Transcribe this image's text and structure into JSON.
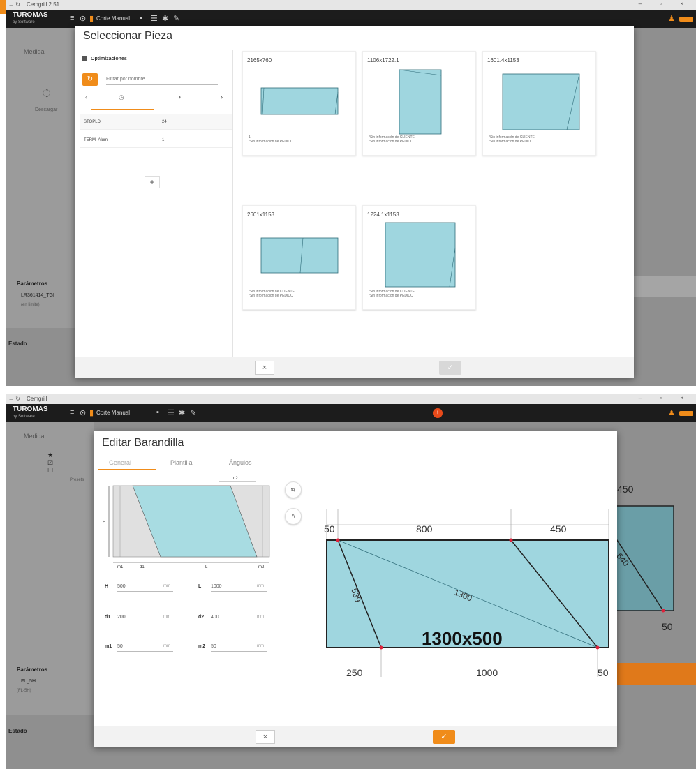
{
  "colors": {
    "accent": "#f08c1a",
    "glass": "#9fd6df",
    "glass_stroke": "#2e6b78",
    "appbar": "#1c1c1c",
    "overlay": "#8f8f8f"
  },
  "top": {
    "window_title": "Cemgrill 2.51",
    "nav_back": "←  ↻",
    "window_controls": "–  ▫  ×",
    "app": {
      "brand": "TUROMAS",
      "brand_sub": "by Software",
      "toolbar_label": "Corte Manual"
    },
    "background": {
      "medida_label": "Medida",
      "descarga_label": "Descargar",
      "parametros_label": "Parámetros",
      "parametros_item": "LR361414_TGI",
      "parametros_sub": "(en límite)",
      "estado_label": "Estado"
    },
    "modal": {
      "title": "Seleccionar Pieza",
      "optimizaciones_label": "Optimizaciones",
      "refresh_icon": "refresh-icon",
      "filter_placeholder": "Filtrar por nombre",
      "tab_prev": "‹",
      "tab_next": "›",
      "tab_icon_1": "◷",
      "tab_icon_2": "◑",
      "optimizations": [
        {
          "name": "STOPLDI",
          "count": "24"
        },
        {
          "name": "TERM_Alumi",
          "count": "1"
        }
      ],
      "add_label": "+",
      "pieces": [
        {
          "dim": "2165x760",
          "note_line1": "1",
          "note_line2": "*Sin información de PEDIDO"
        },
        {
          "dim": "1106x1722.1",
          "note_line1": "*Sin información de CLIENTE",
          "note_line2": "*Sin información de PEDIDO"
        },
        {
          "dim": "1601.4x1153",
          "note_line1": "*Sin información de CLIENTE",
          "note_line2": "*Sin información de PEDIDO"
        },
        {
          "dim": "2601x1153",
          "note_line1": "*Sin información de CLIENTE",
          "note_line2": "*Sin información de PEDIDO"
        },
        {
          "dim": "1224.1x1153",
          "note_line1": "*Sin información de CLIENTE",
          "note_line2": "*Sin información de PEDIDO"
        }
      ],
      "cancel_label": "×",
      "accept_label": "✓"
    }
  },
  "bottom": {
    "window_title": "Cemgrill",
    "nav_back": "←  ↻",
    "window_controls": "–  ▫  ×",
    "app": {
      "brand": "TUROMAS",
      "brand_sub": "by Software",
      "toolbar_label": "Corte Manual",
      "alert_label": "!"
    },
    "background": {
      "medida_label": "Medida",
      "presets_label": "Presets",
      "parametros_label": "Parámetros",
      "parametros_item": "FL_5H",
      "parametros_sub": "(FL-5H)",
      "estado_label": "Estado",
      "bg_450": "450",
      "bg_50": "50",
      "bg_angle": "640"
    },
    "modal": {
      "title": "Editar Barandilla",
      "tabs": [
        "General",
        "Plantilla",
        "Ángulos"
      ],
      "schematic": {
        "h": "H",
        "l": "L",
        "d1": "d1",
        "d2": "d2",
        "m1": "m1",
        "m2": "m2"
      },
      "fields": [
        {
          "label": "H",
          "value": "500",
          "unit": "mm"
        },
        {
          "label": "L",
          "value": "1000",
          "unit": "mm"
        },
        {
          "label": "d1",
          "value": "200",
          "unit": "mm"
        },
        {
          "label": "d2",
          "value": "400",
          "unit": "mm"
        },
        {
          "label": "m1",
          "value": "50",
          "unit": "mm"
        },
        {
          "label": "m2",
          "value": "50",
          "unit": "mm"
        }
      ],
      "swap_btn": "⇆",
      "mirror_btn": "\\\\",
      "preview": {
        "top_left": "50",
        "top_mid": "800",
        "top_right": "450",
        "bottom_left": "250",
        "bottom_mid": "1000",
        "bottom_right": "50",
        "left_edge": "539",
        "diagonal": "1300",
        "size": "1300x500"
      },
      "cancel_label": "×",
      "accept_label": "✓"
    }
  }
}
